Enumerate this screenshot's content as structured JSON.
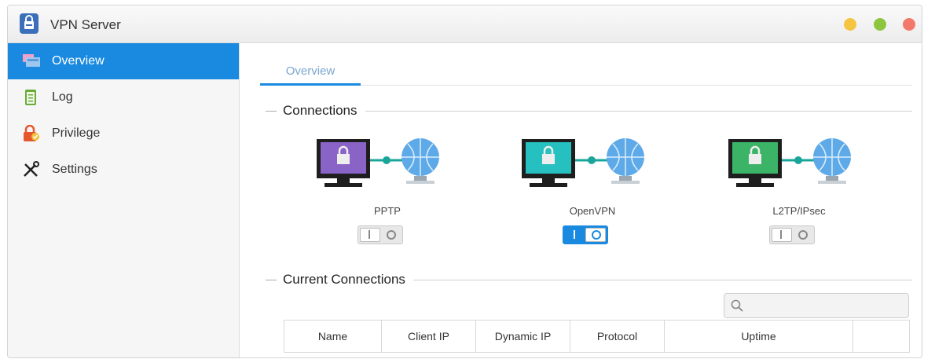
{
  "window": {
    "title": "VPN Server"
  },
  "window_controls": {
    "colors": [
      "#f5c440",
      "#8cc63f",
      "#f2786b"
    ]
  },
  "sidebar": {
    "items": [
      {
        "label": "Overview",
        "icon": "overview-icon",
        "active": true
      },
      {
        "label": "Log",
        "icon": "log-icon",
        "active": false
      },
      {
        "label": "Privilege",
        "icon": "privilege-icon",
        "active": false
      },
      {
        "label": "Settings",
        "icon": "settings-icon",
        "active": false
      }
    ]
  },
  "tabs": [
    {
      "label": "Overview",
      "active": true
    }
  ],
  "connections": {
    "title": "Connections",
    "items": [
      {
        "name": "PPTP",
        "enabled": false,
        "screen_color": "#8a63c7"
      },
      {
        "name": "OpenVPN",
        "enabled": true,
        "screen_color": "#26c0c0"
      },
      {
        "name": "L2TP/IPsec",
        "enabled": false,
        "screen_color": "#3cb467"
      }
    ]
  },
  "current_connections": {
    "title": "Current Connections",
    "search": {
      "placeholder": ""
    },
    "columns": [
      "Name",
      "Client IP",
      "Dynamic IP",
      "Protocol",
      "Uptime",
      ""
    ]
  },
  "colors": {
    "accent": "#1a8ae0"
  }
}
